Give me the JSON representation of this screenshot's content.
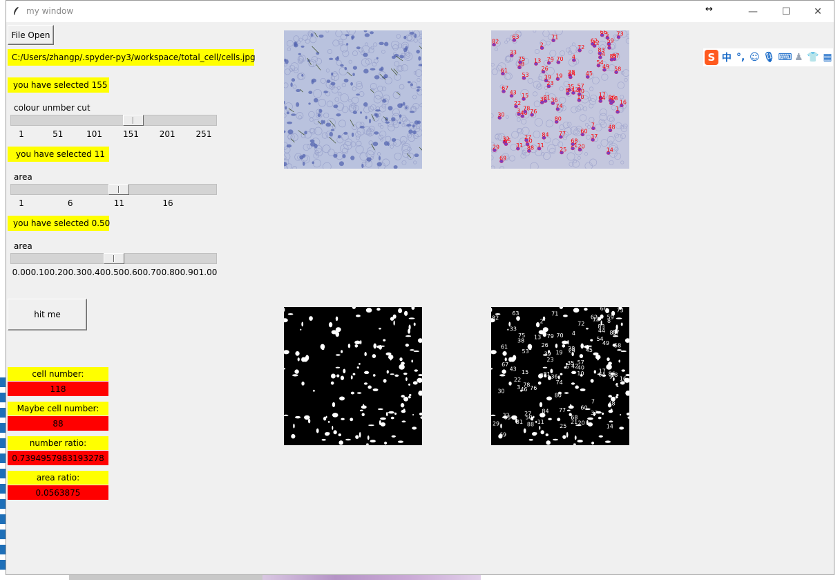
{
  "window": {
    "title": "my window",
    "controls": {
      "minimize": "—",
      "maximize": "☐",
      "close": "✕"
    }
  },
  "file": {
    "open_button": "File Open",
    "path": "C:/Users/zhangp/.spyder-py3/workspace/total_cell/cells.jpg"
  },
  "slider1": {
    "selected_text": "you have selected 155",
    "label": "colour unmber cut",
    "ticks": [
      "1",
      "51",
      "101",
      "151",
      "201",
      "251"
    ],
    "value": 155,
    "min": 1,
    "max": 255
  },
  "slider2": {
    "selected_text": "you have selected 11",
    "label": "area",
    "ticks": [
      "1",
      "6",
      "11",
      "16"
    ],
    "value": 11,
    "min": 1,
    "max": 20
  },
  "slider3": {
    "selected_text": "you have selected 0.50",
    "label": "area",
    "ticks": [
      "0.00",
      "0.10",
      "0.20",
      "0.30",
      "0.40",
      "0.50",
      "0.60",
      "0.70",
      "0.80",
      "0.90",
      "1.00"
    ],
    "value": 0.5,
    "min": 0,
    "max": 1
  },
  "hit_button": "hit me",
  "stats": [
    {
      "label": "cell number:",
      "value": "118"
    },
    {
      "label": "Maybe cell number:",
      "value": "88"
    },
    {
      "label": "number ratio:",
      "value": "0.7394957983193278"
    },
    {
      "label": "area ratio:",
      "value": "0.0563875"
    }
  ],
  "colors": {
    "highlight": "#ffff00",
    "stat_value_bg": "#ff0000",
    "window_bg": "#f0f0f0",
    "cell_image_bg": "#b9c2de",
    "cell_nucleus": "#5566b0",
    "label_red": "#ff0000",
    "label_white": "#ffffff"
  },
  "ime_toolbar": {
    "logo": "S",
    "chinese_mode": "中",
    "punctuation": "°,",
    "icons": [
      "emoji-icon",
      "microphone-icon",
      "keyboard-icon",
      "user-icon",
      "skin-icon",
      "toolbox-icon"
    ]
  },
  "annotated_labels": [
    "82",
    "79",
    "77",
    "71",
    "69",
    "8",
    "62",
    "57",
    "54",
    "59",
    "58",
    "50",
    "53",
    "49",
    "48",
    "46",
    "43",
    "44",
    "42",
    "45",
    "40",
    "39",
    "38",
    "35",
    "36",
    "37",
    "34",
    "33",
    "32",
    "31",
    "30",
    "29",
    "28",
    "27",
    "26",
    "25",
    "24",
    "23",
    "22",
    "21",
    "20",
    "19",
    "18",
    "17",
    "16",
    "15",
    "14",
    "13",
    "12",
    "11",
    "10",
    "9",
    "7",
    "5",
    "6",
    "4",
    "3",
    "2",
    "1",
    "63",
    "64",
    "65",
    "66",
    "67",
    "68",
    "70",
    "72",
    "73",
    "74",
    "75",
    "76",
    "78",
    "80",
    "81",
    "83",
    "84",
    "85",
    "86",
    "87",
    "88",
    "60",
    "61"
  ]
}
